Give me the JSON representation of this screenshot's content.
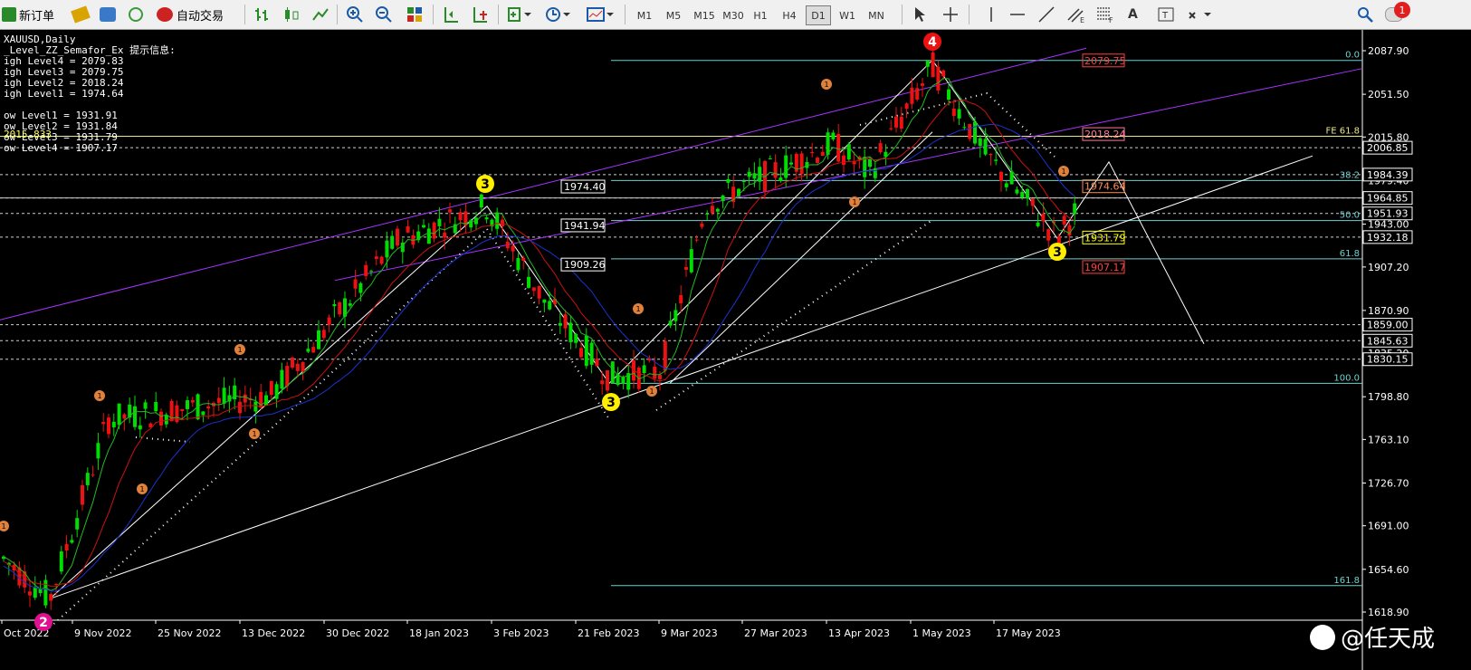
{
  "toolbar": {
    "new_order_label": "新订单",
    "auto_trade_label": "自动交易",
    "timeframes": [
      "M1",
      "M5",
      "M15",
      "M30",
      "H1",
      "H4",
      "D1",
      "W1",
      "MN"
    ],
    "active_timeframe": "D1",
    "notification_count": "1"
  },
  "chart": {
    "symbol_line": "XAUUSD,Daily",
    "indicator_line": "_Level_ZZ_Semafor_Ex 提示信息:",
    "levels_text": [
      "igh Level4 = 2079.83",
      "igh Level3 = 2079.75",
      "igh Level2 = 2018.24",
      "igh Level1 = 1974.64",
      "",
      "ow Level1 = 1931.91",
      "ow Level2 = 1931.84",
      "ow Level3 = 1931.79",
      "ow Level4 = 1907.17"
    ],
    "overlap_label": "2015.833",
    "price_axis": [
      {
        "label": "2087.90",
        "value": 2087.9
      },
      {
        "label": "2051.50",
        "value": 2051.5
      },
      {
        "label": "2015.80",
        "value": 2015.8
      },
      {
        "label": "1979.40",
        "value": 1979.4
      },
      {
        "label": "1943.00",
        "value": 1943.0
      },
      {
        "label": "1907.20",
        "value": 1907.2
      },
      {
        "label": "1870.90",
        "value": 1870.9
      },
      {
        "label": "1835.20",
        "value": 1835.2
      },
      {
        "label": "1798.80",
        "value": 1798.8
      },
      {
        "label": "1763.10",
        "value": 1763.1
      },
      {
        "label": "1726.70",
        "value": 1726.7
      },
      {
        "label": "1691.00",
        "value": 1691.0
      },
      {
        "label": "1654.60",
        "value": 1654.6
      },
      {
        "label": "1618.90",
        "value": 1618.9
      }
    ],
    "price_boxes": [
      {
        "label": "2006.85",
        "value": 2006.85
      },
      {
        "label": "1984.39",
        "value": 1984.39
      },
      {
        "label": "1964.85",
        "value": 1964.85
      },
      {
        "label": "1951.93",
        "value": 1951.93
      },
      {
        "label": "1932.18",
        "value": 1932.18
      },
      {
        "label": "1859.00",
        "value": 1859.0
      },
      {
        "label": "1845.63",
        "value": 1845.63
      },
      {
        "label": "1830.15",
        "value": 1830.15
      }
    ],
    "fib_labels": [
      {
        "label": "0.0",
        "value": 2079.8
      },
      {
        "label": "38.2",
        "value": 1979.4
      },
      {
        "label": "50.0",
        "value": 1946.0
      },
      {
        "label": "61.8",
        "value": 1914.0
      },
      {
        "label": "100.0",
        "value": 1810.0
      },
      {
        "label": "161.8",
        "value": 1641.0
      }
    ],
    "fe_label": "FE 61.8",
    "fe_value": 2016.4,
    "level_tags": [
      {
        "label": "1974.40",
        "value": 1974.4,
        "color": "#ffffff"
      },
      {
        "label": "1941.94",
        "value": 1941.94,
        "color": "#ffffff"
      },
      {
        "label": "1909.26",
        "value": 1909.26,
        "color": "#ffffff"
      }
    ],
    "zz_tags": [
      {
        "label": "2079.75",
        "value": 2079.75,
        "color": "#ff4040"
      },
      {
        "label": "2018.24",
        "value": 2018.24,
        "color": "#ff7a9a"
      },
      {
        "label": "1974.64",
        "value": 1974.64,
        "color": "#ff8a5a"
      },
      {
        "label": "1931.79",
        "value": 1931.79,
        "color": "#ffff00"
      },
      {
        "label": "1907.17",
        "value": 1907.17,
        "color": "#ff4040"
      }
    ],
    "date_labels": [
      "Oct 2022",
      "9 Nov 2022",
      "25 Nov 2022",
      "13 Dec 2022",
      "30 Dec 2022",
      "18 Jan 2023",
      "3 Feb 2023",
      "21 Feb 2023",
      "9 Mar 2023",
      "27 Mar 2023",
      "13 Apr 2023",
      "1 May 2023",
      "17 May 2023"
    ],
    "semafor_big": [
      "4",
      "3",
      "3",
      "3",
      "2"
    ],
    "semafor_small": "1",
    "colors": {
      "bull": "#00dd00",
      "bear": "#ee1111",
      "ma_fast": "#22bb22",
      "ma_mid": "#cc1111",
      "ma_slow": "#1a33cc",
      "fib": "#6fd0d0",
      "channel": "#aa33ff"
    }
  },
  "watermark": {
    "at_text": "@任天成"
  }
}
